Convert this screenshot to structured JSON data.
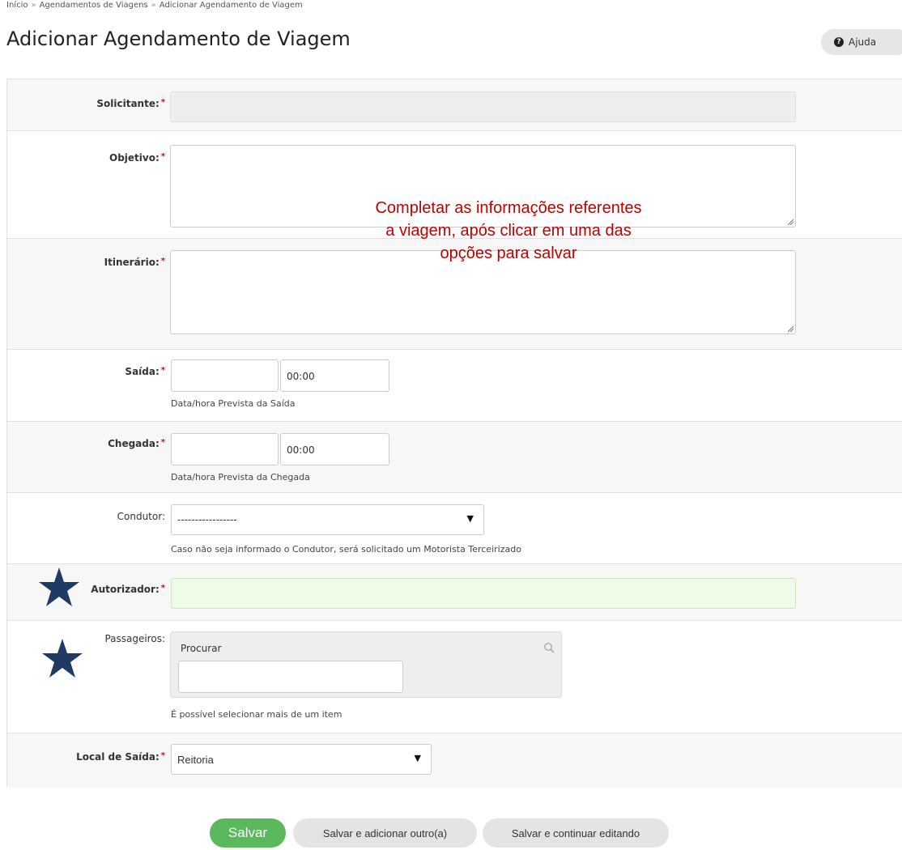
{
  "breadcrumb": {
    "items": [
      "Início",
      "Agendamentos de Viagens",
      "Adicionar Agendamento de Viagem"
    ],
    "separator": "»"
  },
  "page_title": "Adicionar Agendamento de Viagem",
  "help_button": {
    "label": "Ajuda",
    "icon": "question-circle-icon"
  },
  "required_marker": "*",
  "form": {
    "solicitante": {
      "label": "Solicitante:",
      "value": "",
      "disabled": true
    },
    "objetivo": {
      "label": "Objetivo:",
      "value": ""
    },
    "itinerario": {
      "label": "Itinerário:",
      "value": ""
    },
    "saida": {
      "label": "Saída:",
      "date": "",
      "time": "00:00",
      "help": "Data/hora Prevista da Saída"
    },
    "chegada": {
      "label": "Chegada:",
      "date": "",
      "time": "00:00",
      "help": "Data/hora Prevista da Chegada"
    },
    "condutor": {
      "label": "Condutor:",
      "selected": "-----------------",
      "help": "Caso não seja informado o Condutor, será solicitado um Motorista Terceirizado"
    },
    "autorizador": {
      "label": "Autorizador:",
      "value": ""
    },
    "passageiros": {
      "label": "Passageiros:",
      "search_label": "Procurar",
      "value": "",
      "help": "É possível selecionar mais de um item"
    },
    "local_saida": {
      "label": "Local de Saída:",
      "selected": "Reitoria"
    }
  },
  "annotation": {
    "lines": [
      "Completar as informações referentes",
      "a viagem, após clicar em uma das",
      "opções para salvar"
    ],
    "color": "#c00000"
  },
  "star_markers": {
    "color": "#1f3b63",
    "icon": "star-icon"
  },
  "buttons": {
    "save": "Salvar",
    "save_add_another": "Salvar e adicionar outro(a)",
    "save_continue": "Salvar e continuar editando"
  }
}
